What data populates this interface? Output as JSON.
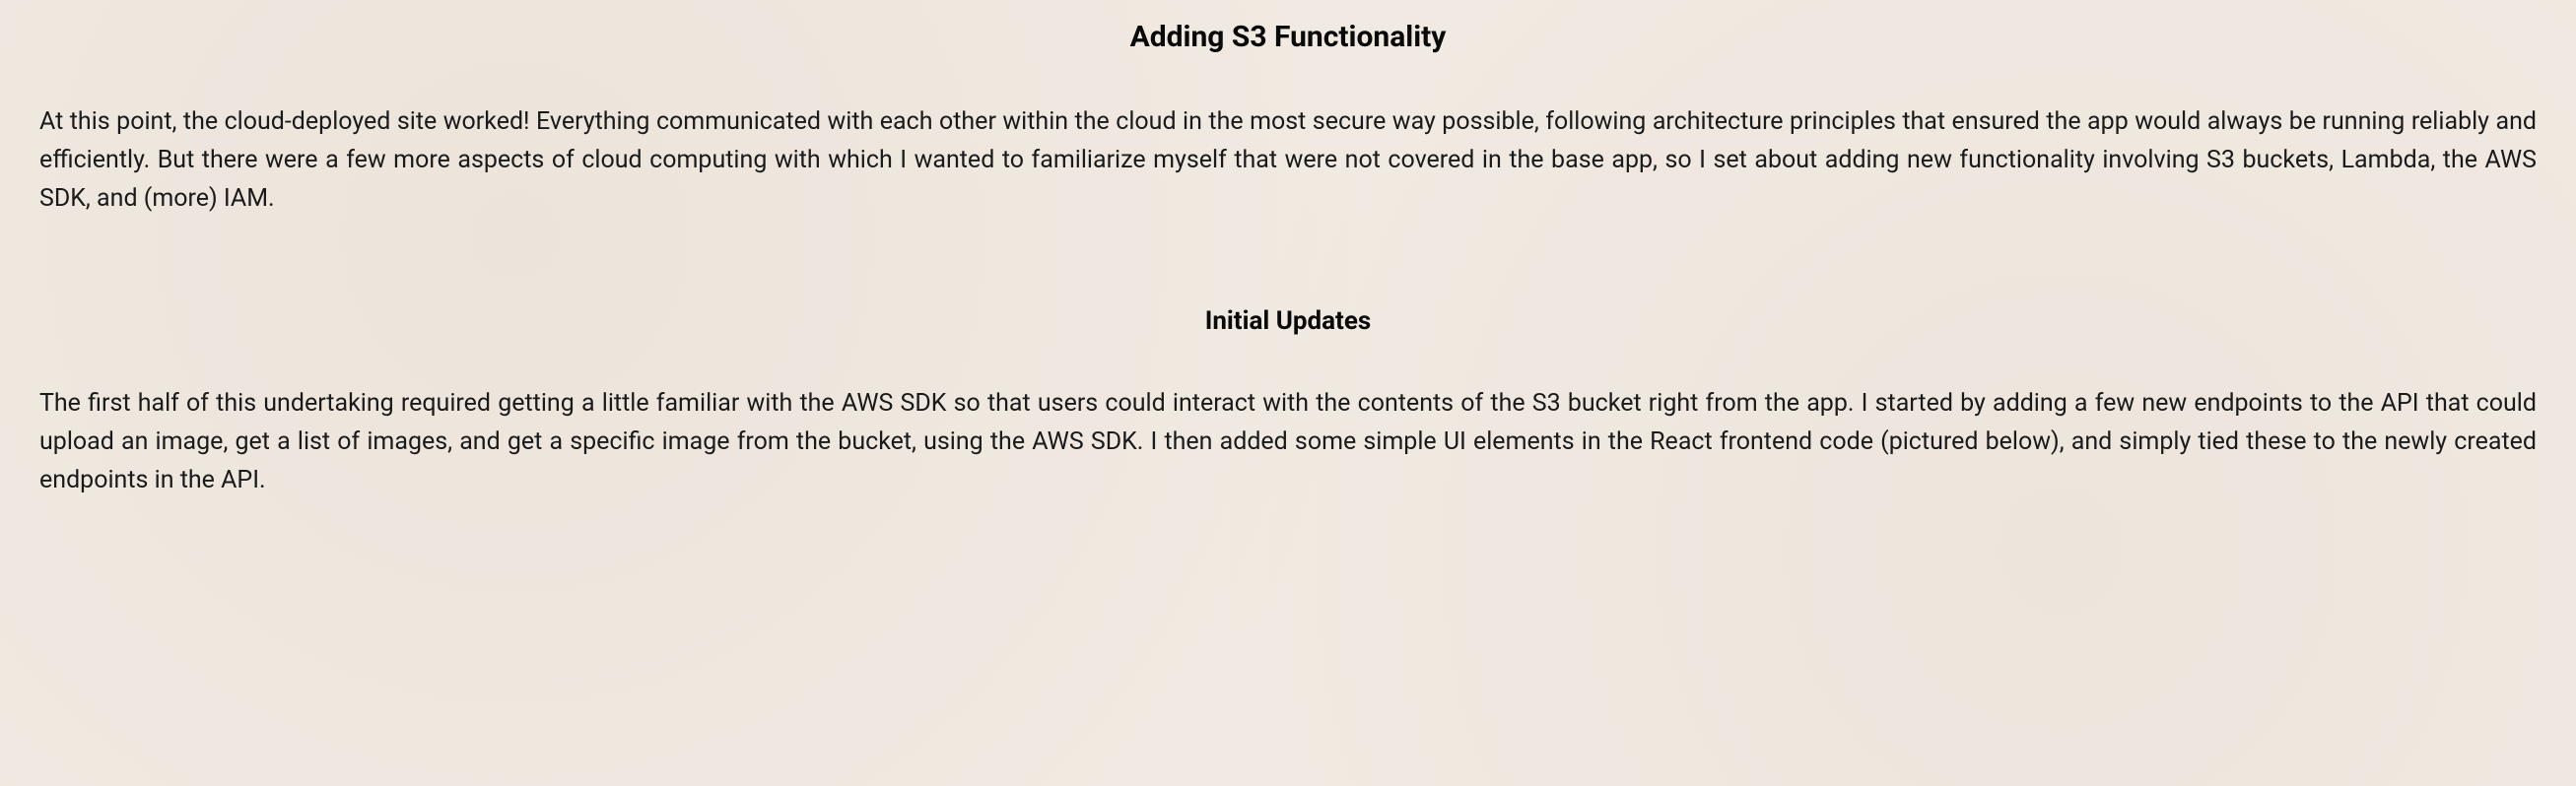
{
  "sections": [
    {
      "title": "Adding S3 Functionality",
      "paragraph": "At this point, the cloud-deployed site worked! Everything communicated with each other within the cloud in the most secure way possible, following architecture principles that ensured the app would always be running reliably and efficiently. But there were a few more aspects of cloud computing with which I wanted to familiarize myself that were not covered in the base app, so I set about adding new functionality involving S3 buckets, Lambda, the AWS SDK, and (more) IAM."
    },
    {
      "title": "Initial Updates",
      "paragraph": "The first half of this undertaking required getting a little familiar with the AWS SDK so that users could interact with the contents of the S3 bucket right from the app. I started by adding a few new endpoints to the API that could upload an image, get a list of images, and get a specific image from the bucket, using the AWS SDK. I then added some simple UI elements in the React frontend code (pictured below), and simply tied these to the newly created endpoints in the API."
    }
  ]
}
